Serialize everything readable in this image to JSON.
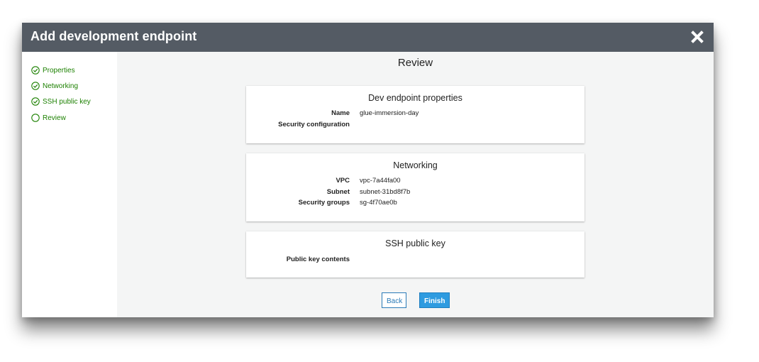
{
  "dialog": {
    "title": "Add development endpoint"
  },
  "sidebar": {
    "steps": [
      {
        "label": "Properties",
        "status": "complete"
      },
      {
        "label": "Networking",
        "status": "complete"
      },
      {
        "label": "SSH public key",
        "status": "complete"
      },
      {
        "label": "Review",
        "status": "current"
      }
    ]
  },
  "review": {
    "title": "Review",
    "properties": {
      "title": "Dev endpoint properties",
      "name_label": "Name",
      "name_value": "glue-immersion-day",
      "security_configuration_label": "Security configuration",
      "security_configuration_value": ""
    },
    "networking": {
      "title": "Networking",
      "vpc_label": "VPC",
      "vpc_value": "vpc-7a44fa00",
      "subnet_label": "Subnet",
      "subnet_value": "subnet-31bd8f7b",
      "security_groups_label": "Security groups",
      "security_groups_value": "sg-4f70ae0b"
    },
    "ssh": {
      "title": "SSH public key",
      "public_key_label": "Public key contents",
      "public_key_value": ""
    }
  },
  "buttons": {
    "back_label": "Back",
    "finish_label": "Finish"
  },
  "colors": {
    "header_bg": "#545b64",
    "step_green": "#1d8102",
    "primary_button": "#2e9be0",
    "secondary_button_border": "#2a7ab8"
  }
}
